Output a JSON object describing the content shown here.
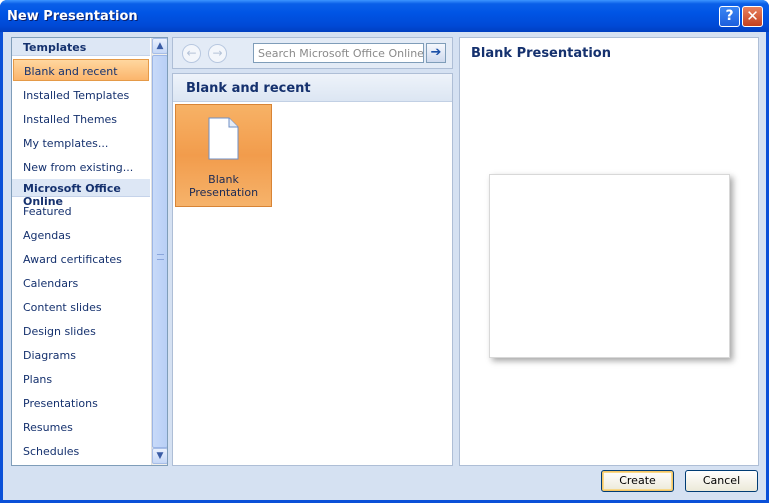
{
  "window": {
    "title": "New Presentation",
    "help_label": "?",
    "close_label": "✕"
  },
  "sidebar": {
    "sections": [
      {
        "label": "Templates"
      },
      {
        "label": "Microsoft Office Online"
      }
    ],
    "items": [
      {
        "label": "Blank and recent",
        "selected": true
      },
      {
        "label": "Installed Templates"
      },
      {
        "label": "Installed Themes"
      },
      {
        "label": "My templates..."
      },
      {
        "label": "New from existing..."
      },
      {
        "label": "Featured"
      },
      {
        "label": "Agendas"
      },
      {
        "label": "Award certificates"
      },
      {
        "label": "Calendars"
      },
      {
        "label": "Content slides"
      },
      {
        "label": "Design slides"
      },
      {
        "label": "Diagrams"
      },
      {
        "label": "Plans"
      },
      {
        "label": "Presentations"
      },
      {
        "label": "Resumes"
      },
      {
        "label": "Schedules"
      }
    ]
  },
  "toolbar": {
    "back_glyph": "←",
    "forward_glyph": "→",
    "search_placeholder": "Search Microsoft Office Online fo",
    "go_glyph": "➔"
  },
  "main": {
    "header": "Blank and recent",
    "tiles": [
      {
        "label": "Blank Presentation",
        "icon": "blank-document-icon"
      }
    ]
  },
  "preview": {
    "title": "Blank Presentation"
  },
  "buttons": {
    "create": "Create",
    "cancel": "Cancel"
  },
  "colors": {
    "title_bar": "#0055e5",
    "selection": "#fbb56c",
    "heading_text": "#15316e",
    "client_bg": "#d5e1f2"
  }
}
